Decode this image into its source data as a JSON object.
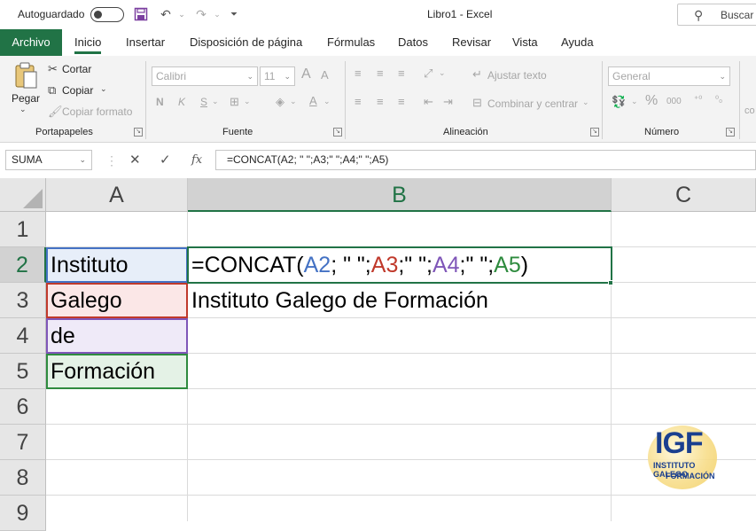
{
  "titlebar": {
    "autosave_label": "Autoguardado",
    "window_title": "Libro1  -  Excel",
    "search_label": "Buscar ("
  },
  "tabs": [
    "Archivo",
    "Inicio",
    "Insertar",
    "Disposición de página",
    "Fórmulas",
    "Datos",
    "Revisar",
    "Vista",
    "Ayuda"
  ],
  "active_tab": "Inicio",
  "ribbon": {
    "clipboard": {
      "paste": "Pegar",
      "cut": "Cortar",
      "copy": "Copiar",
      "format_painter": "Copiar formato",
      "group": "Portapapeles"
    },
    "font": {
      "font_name": "Calibri",
      "font_size": "11",
      "bold": "N",
      "italic": "K",
      "underline": "S",
      "group": "Fuente"
    },
    "alignment": {
      "wrap_text": "Ajustar texto",
      "merge_center": "Combinar y centrar",
      "group": "Alineación"
    },
    "number": {
      "format": "General",
      "percent": "%",
      "comma": "000",
      "group": "Número",
      "extra": "co"
    }
  },
  "formula_bar": {
    "name_box": "SUMA",
    "formula": "=CONCAT(A2; \" \";A3;\" \";A4;\" \";A5)"
  },
  "columns": [
    "A",
    "B",
    "C"
  ],
  "rows": [
    "1",
    "2",
    "3",
    "4",
    "5",
    "6",
    "7",
    "8",
    "9"
  ],
  "cells": {
    "A2": "Instituto",
    "A3": "Galego",
    "A4": "de",
    "A5": "Formación",
    "B2_formula": {
      "prefix": "=CONCAT(",
      "ref1": "A2",
      "sep1": "; \" \";",
      "ref2": "A3",
      "sep2": ";\" \";",
      "ref3": "A4",
      "sep3": ";\" \";",
      "ref4": "A5",
      "suffix": ")"
    },
    "B3": "Instituto Galego de Formación"
  },
  "ref_colors": {
    "A2": "#4472c4",
    "A3": "#c0392b",
    "A4": "#7f56b8",
    "A5": "#2e8b3e"
  },
  "logo": {
    "big": "IGF",
    "line1": "INSTITUTO GALEGO",
    "line2": "FORMACIÓN"
  }
}
